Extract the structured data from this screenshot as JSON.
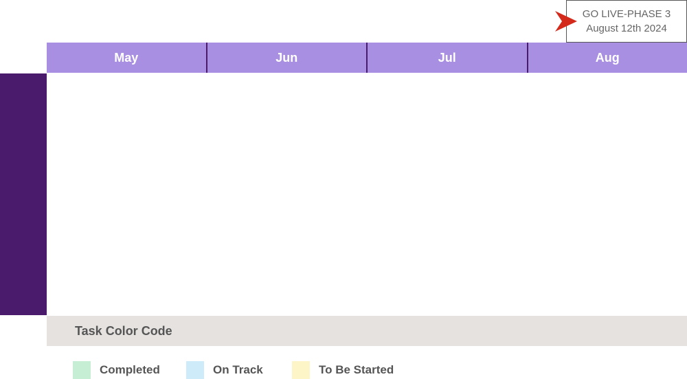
{
  "golive": {
    "title": "GO LIVE-PHASE 3",
    "date": "August 12th 2024",
    "arrow_color": "#d42a1c",
    "arrow_icon": "pointer-arrow-icon"
  },
  "timeline": {
    "months": [
      "May",
      "Jun",
      "Jul",
      "Aug"
    ],
    "header_color": "#a98fe2",
    "divider_color": "#4a1a6c"
  },
  "sidebar": {
    "color": "#4a1a6c"
  },
  "legend": {
    "title": "Task Color Code",
    "items": [
      {
        "label": "Completed",
        "color": "#c6eed5"
      },
      {
        "label": "On Track",
        "color": "#cdebf8"
      },
      {
        "label": "To Be Started",
        "color": "#fdf4c8"
      }
    ]
  }
}
